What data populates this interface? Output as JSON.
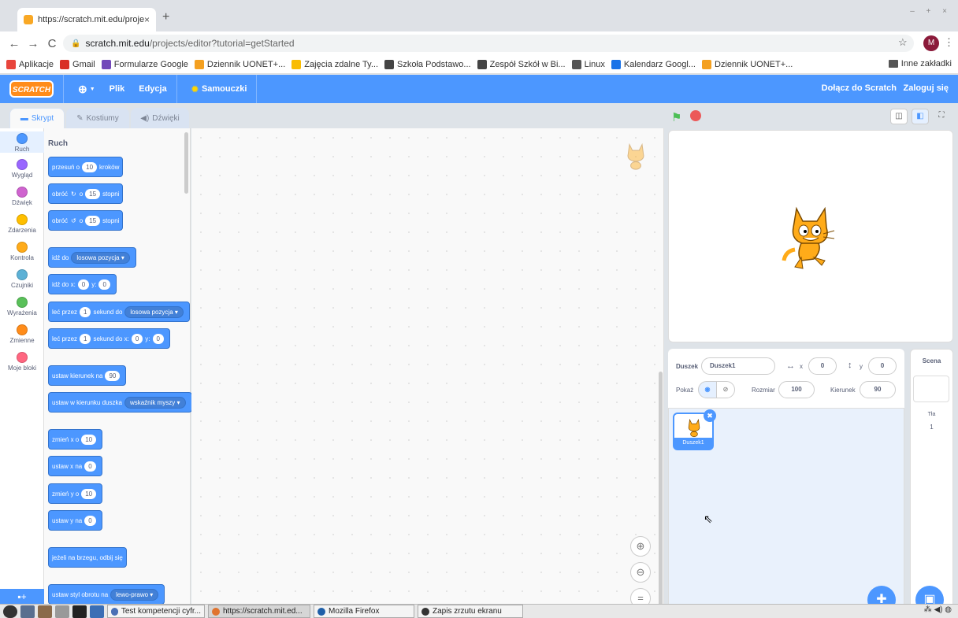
{
  "browser": {
    "tab_title": "https://scratch.mit.edu/projec",
    "tab_close": "×",
    "new_tab": "+",
    "url_domain": "scratch.mit.edu",
    "url_path": "/projects/editor?tutorial=getStarted",
    "account_initial": "M",
    "bookmarks": [
      {
        "label": "Aplikacje",
        "icon": "apps-icon",
        "color": "#e8453c"
      },
      {
        "label": "Gmail",
        "icon": "gmail-icon",
        "color": "#d93025"
      },
      {
        "label": "Formularze Google",
        "icon": "forms-icon",
        "color": "#7248b9"
      },
      {
        "label": "Dziennik UONET+...",
        "icon": "uonet-icon",
        "color": "#f4a020"
      },
      {
        "label": "Zajęcia zdalne Ty...",
        "icon": "classroom-icon",
        "color": "#f9bc02"
      },
      {
        "label": "Szkoła Podstawo...",
        "icon": "globe-icon",
        "color": "#444444"
      },
      {
        "label": "Zespół Szkół w Bi...",
        "icon": "globe-icon",
        "color": "#444444"
      },
      {
        "label": "Linux",
        "icon": "folder-icon",
        "color": "#555555"
      },
      {
        "label": "Kalendarz Googl...",
        "icon": "calendar-icon",
        "color": "#1a73e8"
      },
      {
        "label": "Dziennik UONET+...",
        "icon": "uonet-icon",
        "color": "#f4a020"
      }
    ],
    "other_bookmarks": "Inne zakładki"
  },
  "menu": {
    "logo": "SCRATCH",
    "file": "Plik",
    "edit": "Edycja",
    "tutorials": "Samouczki",
    "join": "Dołącz do Scratch",
    "login": "Zaloguj się"
  },
  "tabs": {
    "code": "Skrypt",
    "costumes": "Kostiumy",
    "sounds": "Dźwięki"
  },
  "categories": [
    {
      "label": "Ruch",
      "color": "#4c97ff"
    },
    {
      "label": "Wygląd",
      "color": "#9966ff"
    },
    {
      "label": "Dźwięk",
      "color": "#cf63cf"
    },
    {
      "label": "Zdarzenia",
      "color": "#ffbf00"
    },
    {
      "label": "Kontrola",
      "color": "#ffab19"
    },
    {
      "label": "Czujniki",
      "color": "#5cb1d6"
    },
    {
      "label": "Wyrażenia",
      "color": "#59c059"
    },
    {
      "label": "Zmienne",
      "color": "#ff8c1a"
    },
    {
      "label": "Moje bloki",
      "color": "#ff6680"
    }
  ],
  "palette": {
    "heading": "Ruch",
    "b1": {
      "a": "przesuń o",
      "v": "10",
      "b": "kroków"
    },
    "b2": {
      "a": "obróć",
      "o": "o",
      "v": "15",
      "b": "stopni"
    },
    "b3": {
      "a": "obróć",
      "o": "o",
      "v": "15",
      "b": "stopni"
    },
    "b4": {
      "a": "idź do",
      "dd": "losowa pozycja"
    },
    "b5": {
      "a": "idź do x:",
      "x": "0",
      "ylab": "y:",
      "y": "0"
    },
    "b6": {
      "a": "leć przez",
      "v": "1",
      "b": "sekund do",
      "dd": "losowa pozycja"
    },
    "b7": {
      "a": "leć przez",
      "v": "1",
      "b": "sekund do x:",
      "x": "0",
      "ylab": "y:",
      "y": "0"
    },
    "b8": {
      "a": "ustaw kierunek na",
      "v": "90"
    },
    "b9": {
      "a": "ustaw w kierunku duszka",
      "dd": "wskaźnik myszy"
    },
    "b10": {
      "a": "zmień x o",
      "v": "10"
    },
    "b11": {
      "a": "ustaw x na",
      "v": "0"
    },
    "b12": {
      "a": "zmień y o",
      "v": "10"
    },
    "b13": {
      "a": "ustaw y na",
      "v": "0"
    },
    "b14": {
      "a": "jeżeli na brzegu, odbij się"
    },
    "b15": {
      "a": "ustaw styl obrotu na",
      "dd": "lewo-prawo"
    }
  },
  "sprite_info": {
    "sprite_label": "Duszek",
    "sprite_name": "Duszek1",
    "x_label": "x",
    "x": "0",
    "y_label": "y",
    "y": "0",
    "show_label": "Pokaż",
    "size_label": "Rozmiar",
    "size": "100",
    "direction_label": "Kierunek",
    "direction": "90"
  },
  "sprite_list": [
    {
      "name": "Duszek1"
    }
  ],
  "scene": {
    "label": "Scena",
    "backdrops_label": "Tła",
    "backdrops_count": "1"
  },
  "taskbar": {
    "tasks": [
      {
        "label": "Test kompetencji cyfr...",
        "color": "#4a6fb5"
      },
      {
        "label": "https://scratch.mit.ed...",
        "color": "#e0742f"
      },
      {
        "label": "Mozilla Firefox",
        "color": "#1f5fa8"
      },
      {
        "label": "Zapis zrzutu ekranu",
        "color": "#333333"
      }
    ]
  }
}
